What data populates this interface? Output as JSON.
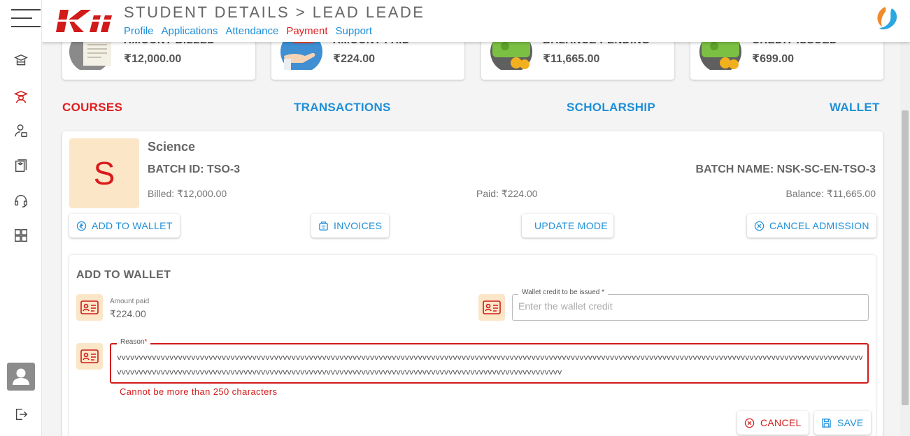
{
  "header": {
    "title": "STUDENT DETAILS > LEAD LEADE",
    "nav": [
      {
        "label": "Profile",
        "active": false
      },
      {
        "label": "Applications",
        "active": false
      },
      {
        "label": "Attendance",
        "active": false
      },
      {
        "label": "Payment",
        "active": true
      },
      {
        "label": "Support",
        "active": false
      }
    ]
  },
  "sidebar": {
    "icons": [
      "graduation-icon",
      "student-icon",
      "person-icon",
      "courses-icon",
      "headset-icon",
      "dashboard-icon"
    ],
    "bottom": [
      "avatar",
      "logout-icon"
    ]
  },
  "stats": [
    {
      "label": "AMOUNT BILLED",
      "value": "₹12,000.00",
      "icon": "receipt-icon"
    },
    {
      "label": "AMOUNT PAID",
      "value": "₹224.00",
      "icon": "payment-hand-icon"
    },
    {
      "label": "BALANCE PENDING",
      "value": "₹11,665.00",
      "icon": "money-coins-icon"
    },
    {
      "label": "CREDIT ISSUED",
      "value": "₹699.00",
      "icon": "money-coins-icon"
    }
  ],
  "tabs": {
    "courses": "COURSES",
    "transactions": "TRANSACTIONS",
    "scholarship": "SCHOLARSHIP",
    "wallet": "WALLET",
    "active": "COURSES"
  },
  "course": {
    "initial": "S",
    "name": "Science",
    "batch_id": "BATCH ID: TSO-3",
    "batch_name": "BATCH NAME: NSK-SC-EN-TSO-3",
    "billed": "Billed: ₹12,000.00",
    "paid": "Paid: ₹224.00",
    "balance": "Balance: ₹11,665.00",
    "actions": {
      "add_to_wallet": "ADD TO WALLET",
      "invoices": "INVOICES",
      "update_mode": "UPDATE MODE",
      "cancel_admission": "CANCEL ADMISSION"
    }
  },
  "wallet_form": {
    "title": "ADD TO WALLET",
    "amount_paid_label": "Amount paid",
    "amount_paid_value": "₹224.00",
    "credit_label": "Wallet credit to be issued",
    "credit_placeholder": "Enter the wallet credit",
    "reason_label": "Reason",
    "required_mark": "*",
    "reason_value": "vvvvvvvvvvvvvvvvvvvvvvvvvvvvvvvvvvvvvvvvvvvvvvvvvvvvvvvvvvvvvvvvvvvvvvvvvvvvvvvvvvvvvvvvvvvvvvvvvvvvvvvvvvvvvvvvvvvvvvvvvvvvvvvvvvvvvvvvvvvvvvvvvvvvvvvvvvvvvvvvvvvvvvvvvvvvvvvvvvvvvvvvvvvvvvvvvvvvvvvvvvvvvvvvvvvvvvvvvvvvvvvvvvvvvvvvvvvvvvvvvvvvvvvvvvvvvvvvvvvvvvvvvvvvvvvvv",
    "error": "Cannot be more than 250 characters",
    "cancel": "CANCEL",
    "save": "SAVE"
  },
  "colors": {
    "accent_blue": "#1e8fd8",
    "accent_red": "#e11d1d",
    "icon_bg": "#fbe6c8"
  }
}
